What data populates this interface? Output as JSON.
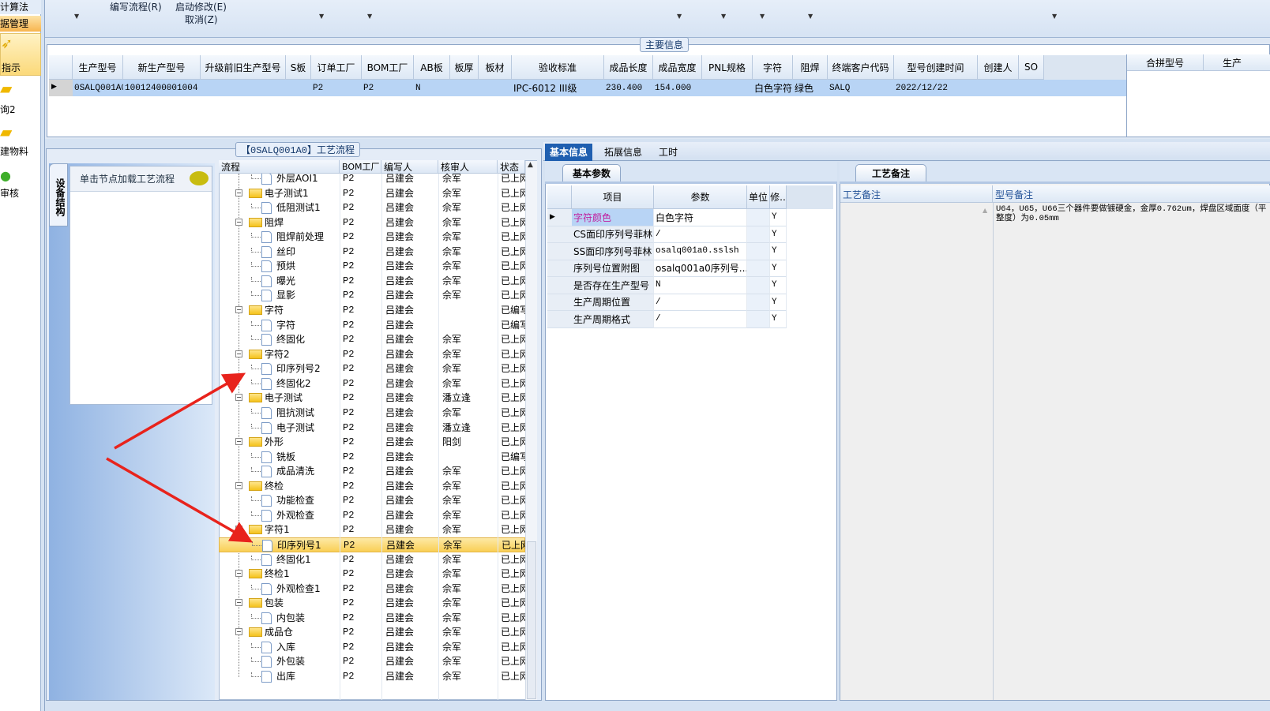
{
  "nav": {
    "items": [
      "计算法",
      "据管理",
      "指示",
      "询2",
      "建物料",
      "审核"
    ]
  },
  "toolbar": {
    "write_flow": "编写流程(R)",
    "start_modify": "启动修改(E)",
    "cancel": "取消(Z)"
  },
  "main_info": {
    "title": "主要信息",
    "columns": [
      "生产型号",
      "新生产型号",
      "升级前旧生产型号",
      "S板",
      "订单工厂",
      "BOM工厂",
      "AB板",
      "板厚",
      "板材",
      "验收标准",
      "成品长度",
      "成品宽度",
      "PNL规格",
      "字符",
      "阻焊",
      "终端客户代码",
      "型号创建时间",
      "创建人",
      "SO"
    ],
    "row": [
      "0SALQ001A0",
      "10012400001004",
      "",
      "",
      "P2",
      "P2",
      "N",
      "",
      "",
      "IPC-6012 III级",
      "230.400",
      "154.000",
      "",
      "白色字符",
      "绿色",
      "SALQ",
      "2022/12/22",
      "",
      ""
    ],
    "side_columns": [
      "合拼型号",
      "生产"
    ]
  },
  "flow_panel": {
    "title": "【0SALQ001A0】工艺流程",
    "vertical_tab": "设备结构",
    "hint": "单击节点加载工艺流程",
    "columns": [
      "流程",
      "BOM工厂",
      "编写人",
      "核审人",
      "状态"
    ],
    "rows": [
      {
        "name": "外层AOI1",
        "type": "file",
        "bom": "P2",
        "writer": "吕建会",
        "reviewer": "佘军",
        "status": "已上网"
      },
      {
        "name": "电子测试1",
        "type": "folder",
        "bom": "P2",
        "writer": "吕建会",
        "reviewer": "佘军",
        "status": "已上网"
      },
      {
        "name": "低阻测试1",
        "type": "file",
        "bom": "P2",
        "writer": "吕建会",
        "reviewer": "佘军",
        "status": "已上网"
      },
      {
        "name": "阻焊",
        "type": "folder",
        "bom": "P2",
        "writer": "吕建会",
        "reviewer": "佘军",
        "status": "已上网"
      },
      {
        "name": "阻焊前处理",
        "type": "file",
        "bom": "P2",
        "writer": "吕建会",
        "reviewer": "佘军",
        "status": "已上网"
      },
      {
        "name": "丝印",
        "type": "file",
        "bom": "P2",
        "writer": "吕建会",
        "reviewer": "佘军",
        "status": "已上网"
      },
      {
        "name": "预烘",
        "type": "file",
        "bom": "P2",
        "writer": "吕建会",
        "reviewer": "佘军",
        "status": "已上网"
      },
      {
        "name": "曝光",
        "type": "file",
        "bom": "P2",
        "writer": "吕建会",
        "reviewer": "佘军",
        "status": "已上网"
      },
      {
        "name": "显影",
        "type": "file",
        "bom": "P2",
        "writer": "吕建会",
        "reviewer": "佘军",
        "status": "已上网"
      },
      {
        "name": "字符",
        "type": "folder",
        "bom": "P2",
        "writer": "吕建会",
        "reviewer": "",
        "status": "已编写"
      },
      {
        "name": "字符",
        "type": "file",
        "bom": "P2",
        "writer": "吕建会",
        "reviewer": "",
        "status": "已编写"
      },
      {
        "name": "终固化",
        "type": "file",
        "bom": "P2",
        "writer": "吕建会",
        "reviewer": "佘军",
        "status": "已上网"
      },
      {
        "name": "字符2",
        "type": "folder",
        "bom": "P2",
        "writer": "吕建会",
        "reviewer": "佘军",
        "status": "已上网"
      },
      {
        "name": "印序列号2",
        "type": "file",
        "bom": "P2",
        "writer": "吕建会",
        "reviewer": "佘军",
        "status": "已上网"
      },
      {
        "name": "终固化2",
        "type": "file",
        "bom": "P2",
        "writer": "吕建会",
        "reviewer": "佘军",
        "status": "已上网"
      },
      {
        "name": "电子测试",
        "type": "folder",
        "bom": "P2",
        "writer": "吕建会",
        "reviewer": "潘立逢",
        "status": "已上网"
      },
      {
        "name": "阻抗测试",
        "type": "file",
        "bom": "P2",
        "writer": "吕建会",
        "reviewer": "佘军",
        "status": "已上网"
      },
      {
        "name": "电子测试",
        "type": "file",
        "bom": "P2",
        "writer": "吕建会",
        "reviewer": "潘立逢",
        "status": "已上网"
      },
      {
        "name": "外形",
        "type": "folder",
        "bom": "P2",
        "writer": "吕建会",
        "reviewer": "阳剑",
        "status": "已上网"
      },
      {
        "name": "铣板",
        "type": "file",
        "bom": "P2",
        "writer": "吕建会",
        "reviewer": "",
        "status": "已编写"
      },
      {
        "name": "成品清洗",
        "type": "file",
        "bom": "P2",
        "writer": "吕建会",
        "reviewer": "佘军",
        "status": "已上网"
      },
      {
        "name": "终检",
        "type": "folder",
        "bom": "P2",
        "writer": "吕建会",
        "reviewer": "佘军",
        "status": "已上网"
      },
      {
        "name": "功能检查",
        "type": "file",
        "bom": "P2",
        "writer": "吕建会",
        "reviewer": "佘军",
        "status": "已上网"
      },
      {
        "name": "外观检查",
        "type": "file",
        "bom": "P2",
        "writer": "吕建会",
        "reviewer": "佘军",
        "status": "已上网"
      },
      {
        "name": "字符1",
        "type": "folder",
        "bom": "P2",
        "writer": "吕建会",
        "reviewer": "佘军",
        "status": "已上网"
      },
      {
        "name": "印序列号1",
        "type": "file",
        "bom": "P2",
        "writer": "吕建会",
        "reviewer": "佘军",
        "status": "已上网",
        "selected": true
      },
      {
        "name": "终固化1",
        "type": "file",
        "bom": "P2",
        "writer": "吕建会",
        "reviewer": "佘军",
        "status": "已上网"
      },
      {
        "name": "终检1",
        "type": "folder",
        "bom": "P2",
        "writer": "吕建会",
        "reviewer": "佘军",
        "status": "已上网"
      },
      {
        "name": "外观检查1",
        "type": "file",
        "bom": "P2",
        "writer": "吕建会",
        "reviewer": "佘军",
        "status": "已上网"
      },
      {
        "name": "包装",
        "type": "folder",
        "bom": "P2",
        "writer": "吕建会",
        "reviewer": "佘军",
        "status": "已上网"
      },
      {
        "name": "内包装",
        "type": "file",
        "bom": "P2",
        "writer": "吕建会",
        "reviewer": "佘军",
        "status": "已上网"
      },
      {
        "name": "成品仓",
        "type": "folder",
        "bom": "P2",
        "writer": "吕建会",
        "reviewer": "佘军",
        "status": "已上网"
      },
      {
        "name": "入库",
        "type": "file",
        "bom": "P2",
        "writer": "吕建会",
        "reviewer": "佘军",
        "status": "已上网"
      },
      {
        "name": "外包装",
        "type": "file",
        "bom": "P2",
        "writer": "吕建会",
        "reviewer": "佘军",
        "status": "已上网"
      },
      {
        "name": "出库",
        "type": "file",
        "bom": "P2",
        "writer": "吕建会",
        "reviewer": "佘军",
        "status": "已上网"
      }
    ]
  },
  "detail": {
    "tabs": [
      "基本信息",
      "拓展信息",
      "工时"
    ],
    "active_tab": "基本信息",
    "params": {
      "tab": "基本参数",
      "columns": [
        "项目",
        "参数",
        "单位",
        "修.."
      ],
      "rows": [
        [
          "字符颜色",
          "白色字符",
          "",
          "Y"
        ],
        [
          "CS面印序列号菲林",
          "/",
          "",
          "Y"
        ],
        [
          "SS面印序列号菲林",
          "osalq001a0.sslsh",
          "",
          "Y"
        ],
        [
          "序列号位置附图",
          "osalq001a0序列号...",
          "",
          "Y"
        ],
        [
          "是否存在生产型号",
          "N",
          "",
          "Y"
        ],
        [
          "生产周期位置",
          "/",
          "",
          "Y"
        ],
        [
          "生产周期格式",
          "/",
          "",
          "Y"
        ]
      ]
    },
    "remarks": {
      "tab": "工艺备注",
      "columns": [
        "工艺备注",
        "型号备注"
      ],
      "model_remark": "U64，U65，U66三个器件要做镀硬金，金厚0.762um，焊盘区域面度（平整度）为0.05mm"
    }
  },
  "colors": {
    "selection": "#f9cf55",
    "row_highlight": "#b8d4f5",
    "accent": "#1f5fb0",
    "annotation_arrow": "#e8231c",
    "param_highlight_text": "#c0209f"
  }
}
